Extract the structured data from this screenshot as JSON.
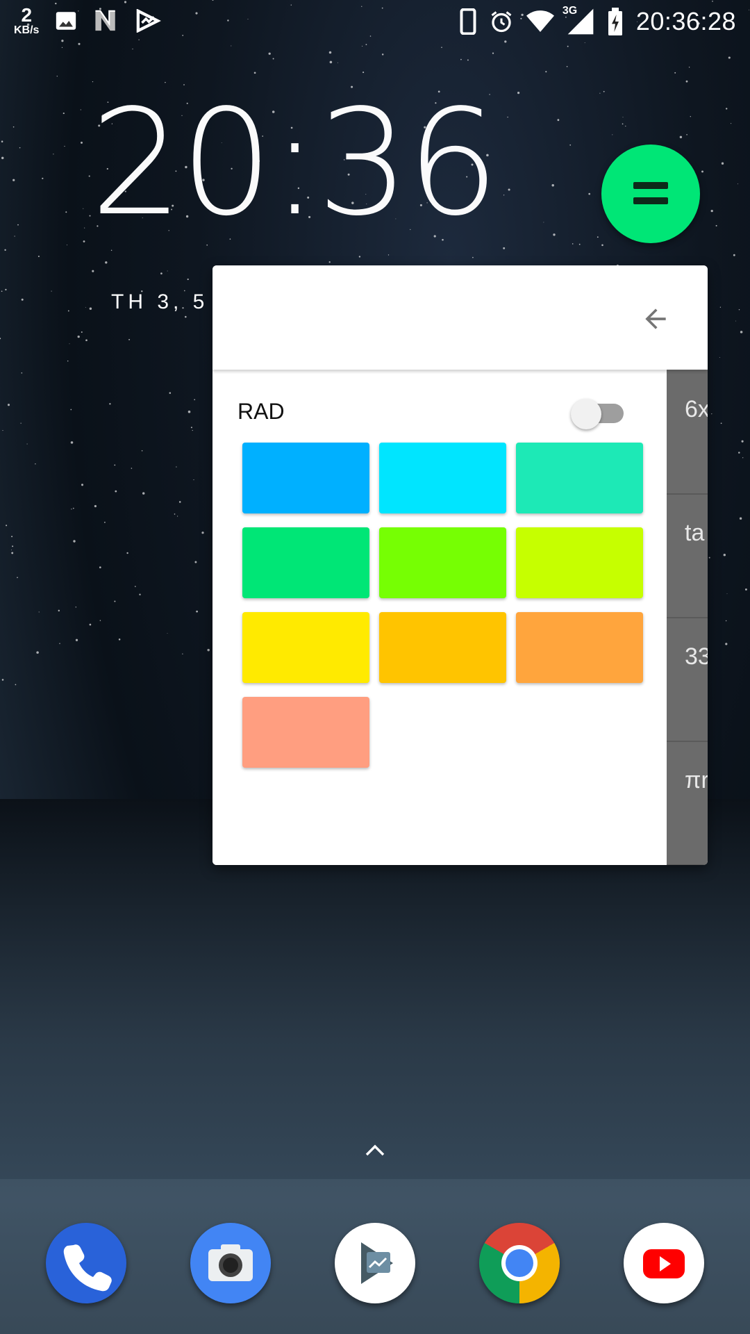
{
  "status_bar": {
    "net_speed_value": "2",
    "net_speed_unit": "KB/s",
    "network_label": "3G",
    "time": "20:36:28",
    "icons_left": [
      "image-icon",
      "n-notification-icon",
      "play-games-icon"
    ],
    "icons_right": [
      "phone-device-icon",
      "alarm-icon",
      "wifi-icon",
      "cell-signal-icon",
      "battery-charging-icon"
    ]
  },
  "clock": {
    "time": "20:36",
    "date": "TH 3, 5"
  },
  "fab": {
    "icon": "equals-icon",
    "color": "#00e676"
  },
  "calculator": {
    "mode_label": "RAD",
    "rad_toggle": false,
    "back_icon": "arrow-back-icon",
    "colors": [
      "#00b0ff",
      "#00e5ff",
      "#1de9b6",
      "#00e676",
      "#76ff03",
      "#c6ff00",
      "#ffea00",
      "#ffc400",
      "#ffa53d",
      "#ff9e80"
    ],
    "side_items": [
      "6x",
      "ta",
      "33",
      "πr"
    ]
  },
  "dock": {
    "apps": [
      "Phone",
      "Camera",
      "Play Store",
      "Chrome",
      "YouTube"
    ]
  }
}
